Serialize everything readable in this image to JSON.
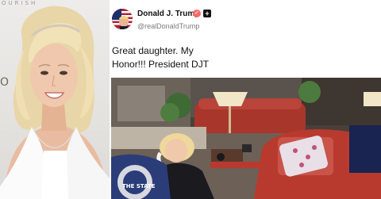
{
  "left_photo": {
    "backdrop_text": "OURISH",
    "backdrop_text_2": "O"
  },
  "post": {
    "author": {
      "name": "Donald J. Trump",
      "handle": "@realDonaldTrump",
      "verified_icon": "verified-badge-icon",
      "plus_icon": "plus-icon"
    },
    "text_line_1": "Great daughter. My",
    "text_line_2": "Honor!!! President DJT",
    "image": {
      "pillow_text": "THE STATE"
    }
  },
  "colors": {
    "verified_badge": "#f56b6b",
    "sofa_red": "#b83a2e",
    "text_primary": "#111111",
    "text_secondary": "#7c7c7c"
  }
}
